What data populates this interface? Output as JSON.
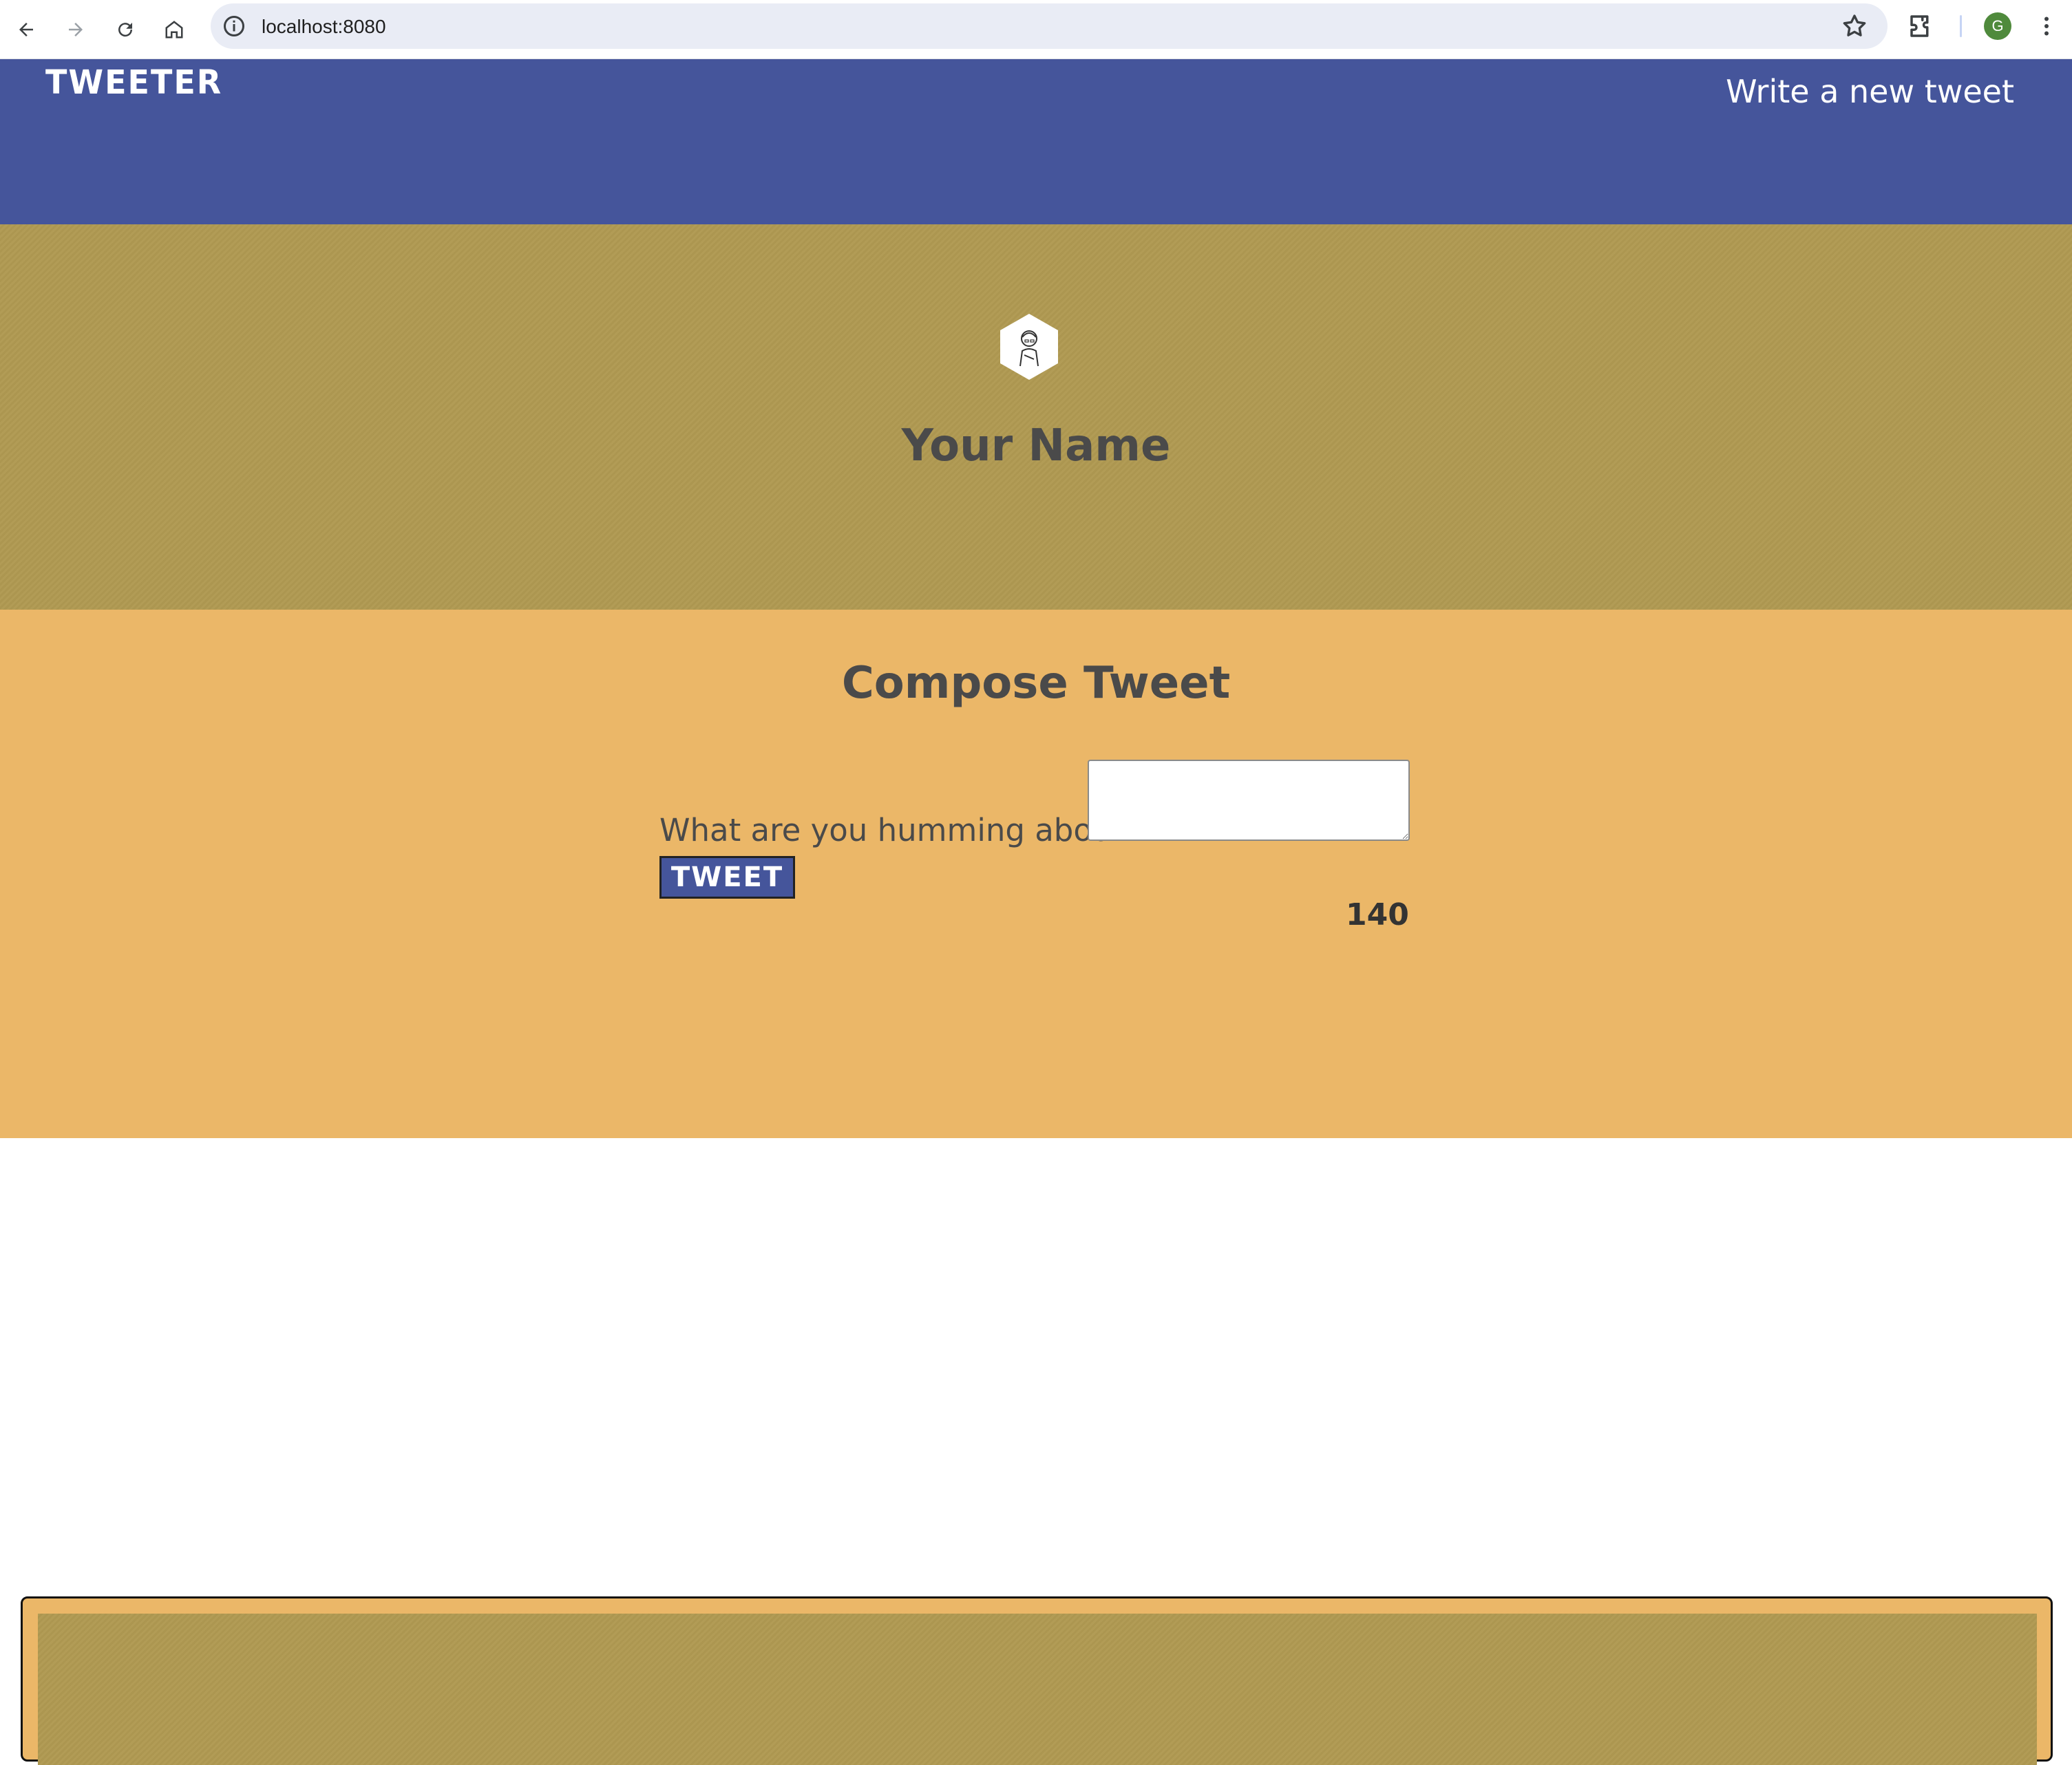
{
  "browser": {
    "url": "localhost:8080",
    "profile_initial": "G",
    "icons": [
      "back-arrow-icon",
      "forward-arrow-icon",
      "reload-icon",
      "home-icon",
      "site-info-icon",
      "bookmark-star-icon",
      "extensions-icon",
      "menu-dots-icon"
    ],
    "accent": "#4f8a3c"
  },
  "nav": {
    "logo": "TWEETER",
    "write_link": "Write a new tweet",
    "background": "#45559b"
  },
  "profile": {
    "name": "Your Name",
    "avatar_icon": "user-avatar-hexagon-icon",
    "background": "#b09a52"
  },
  "compose": {
    "title": "Compose Tweet",
    "label": "What are you humming about?",
    "textarea_value": "",
    "button_label": "TWEET",
    "counter": "140",
    "background": "#ebb768"
  }
}
